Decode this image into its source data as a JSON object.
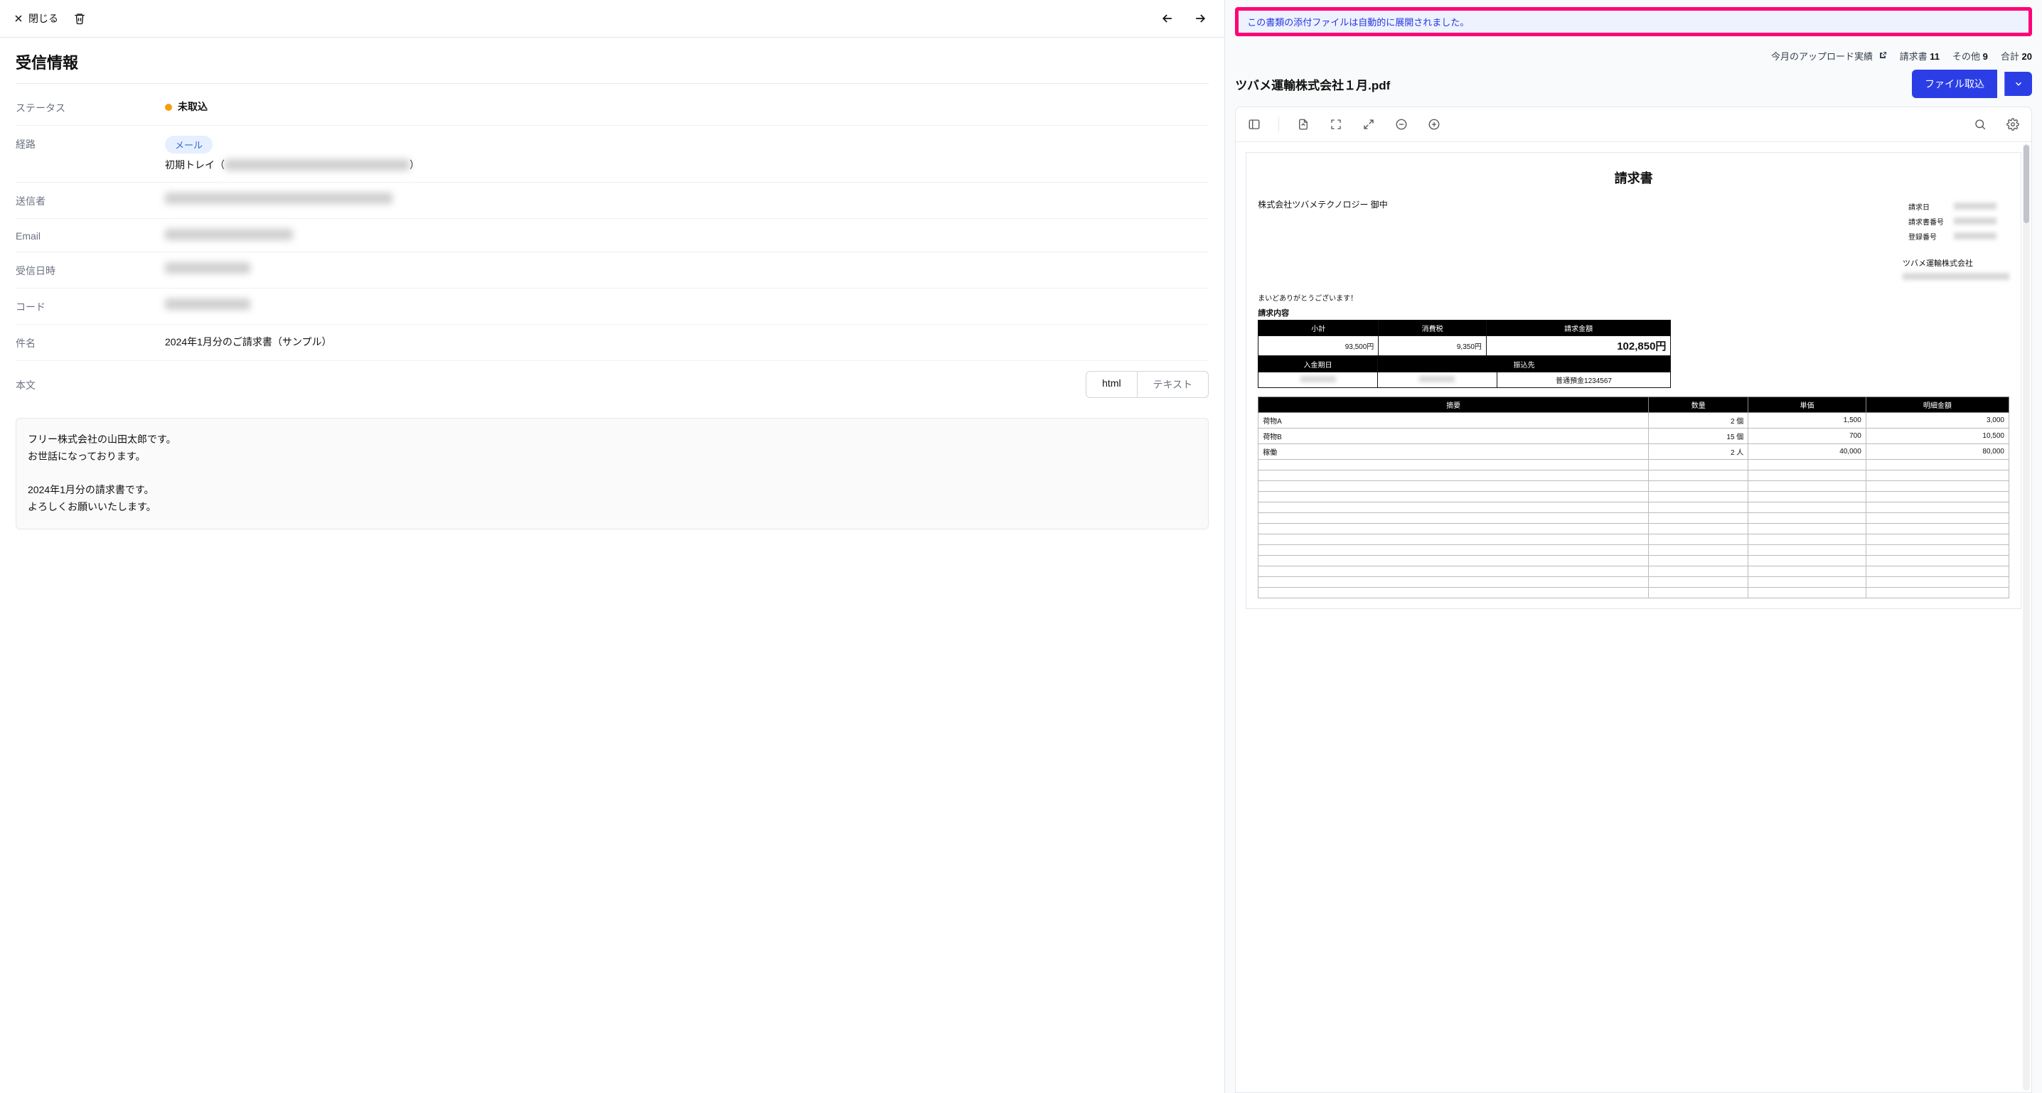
{
  "header": {
    "close_label": "閉じる"
  },
  "info": {
    "title": "受信情報",
    "fields": {
      "status_label": "ステータス",
      "status_value": "未取込",
      "route_label": "経路",
      "route_badge": "メール",
      "route_prefix": "初期トレイ（",
      "route_suffix": "）",
      "sender_label": "送信者",
      "email_label": "Email",
      "received_label": "受信日時",
      "code_label": "コード",
      "subject_label": "件名",
      "subject_value": "2024年1月分のご請求書（サンプル）",
      "body_label": "本文",
      "body_tabs": {
        "html": "html",
        "text": "テキスト"
      },
      "body_text": "フリー株式会社の山田太郎です。\nお世話になっております。\n\n2024年1月分の請求書です。\nよろしくお願いいたします。"
    }
  },
  "right": {
    "alert": "この書類の添付ファイルは自動的に展開されました。",
    "stats": {
      "upload_label": "今月のアップロード実績",
      "invoice_label": "請求書",
      "invoice_count": "11",
      "other_label": "その他",
      "other_count": "9",
      "total_label": "合計",
      "total_count": "20"
    },
    "file_title": "ツバメ運輸株式会社１月.pdf",
    "import_button": "ファイル取込"
  },
  "invoice": {
    "title": "請求書",
    "to": "株式会社ツバメテクノロジー 御中",
    "meta": {
      "date_label": "請求日",
      "number_label": "請求書番号",
      "reg_label": "登録番号"
    },
    "from": "ツバメ運輸株式会社",
    "thanks": "まいどありがとうございます！",
    "section_summary": "請求内容",
    "summary": {
      "subtotal_label": "小計",
      "subtotal": "93,500円",
      "tax_label": "消費税",
      "tax": "9,350円",
      "total_label": "請求金額",
      "total": "102,850円"
    },
    "payment": {
      "due_label": "入金期日",
      "bank_label": "振込先",
      "account": "普通預金1234567"
    },
    "detail_headers": {
      "desc": "摘要",
      "qty": "数量",
      "unit": "単価",
      "amount": "明細金額"
    },
    "details": [
      {
        "desc": "荷物A",
        "qty": "2 個",
        "unit": "1,500",
        "amount": "3,000"
      },
      {
        "desc": "荷物B",
        "qty": "15 個",
        "unit": "700",
        "amount": "10,500"
      },
      {
        "desc": "稼働",
        "qty": "2 人",
        "unit": "40,000",
        "amount": "80,000"
      }
    ]
  }
}
